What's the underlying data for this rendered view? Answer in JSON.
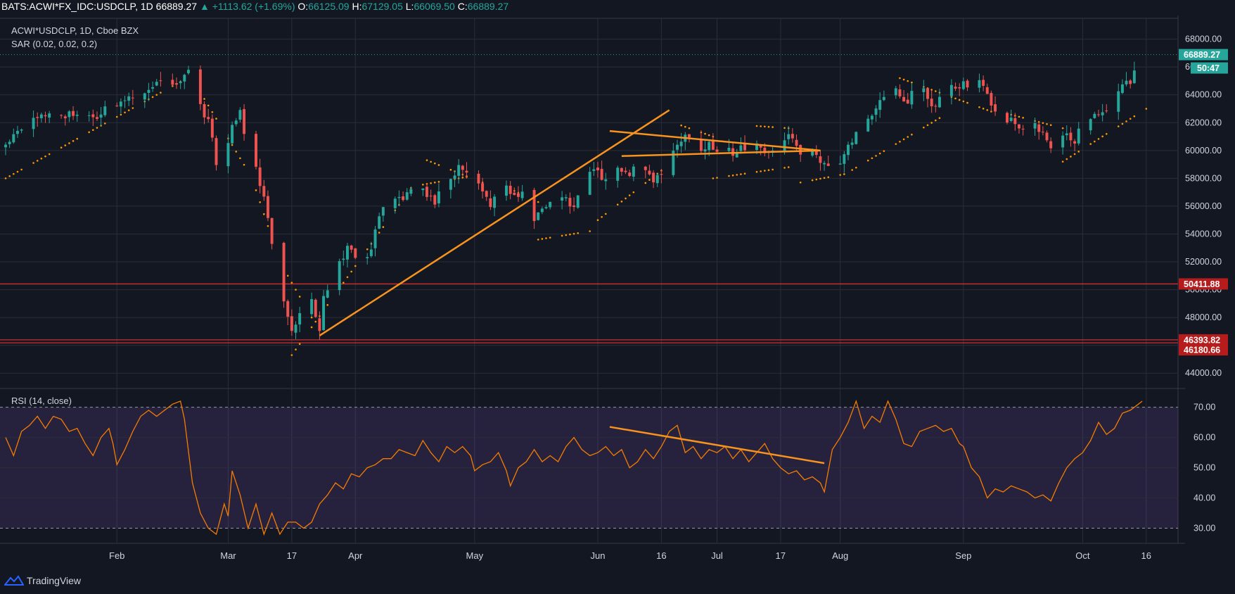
{
  "header": {
    "symbol": "BATS:ACWI*FX_IDC:USDCLP, 1D",
    "last": "66889.27",
    "change": "▲ +1113.62 (+1.69%)",
    "open_label": "O:",
    "open": "66125.09",
    "high_label": "H:",
    "high": "67129.05",
    "low_label": "L:",
    "low": "66069.50",
    "close_label": "C:",
    "close": "66889.27"
  },
  "legend": {
    "main": "ACWI*USDCLP, 1D, Cboe BZX",
    "sar": "SAR (0.02, 0.02, 0.2)",
    "rsi": "RSI (14, close)"
  },
  "footer": {
    "brand": "TradingView",
    "logo_icon": "tradingview-logo-icon"
  },
  "colors": {
    "background": "#131722",
    "grid": "#2a2e39",
    "up": "#26a69a",
    "down": "#ef5350",
    "sar": "#ff9800",
    "trendline": "#f7931e",
    "support": "#d32f2f",
    "rsi_line": "#f57c00",
    "rsi_band": "#7e57c2"
  },
  "chart_data": [
    {
      "type": "candlestick",
      "title": "ACWI*USDCLP, 1D, Cboe BZX",
      "ylim": [
        43000,
        69700
      ],
      "y_ticks": [
        "44000.00",
        "46000.00",
        "48000.00",
        "50000.00",
        "52000.00",
        "54000.00",
        "56000.00",
        "58000.00",
        "60000.00",
        "62000.00",
        "64000.00",
        "66000.00",
        "68000.00"
      ],
      "x_ticks": [
        {
          "label": "Feb",
          "day": 28
        },
        {
          "label": "Mar",
          "day": 56
        },
        {
          "label": "17",
          "day": 72
        },
        {
          "label": "Apr",
          "day": 88
        },
        {
          "label": "May",
          "day": 118
        },
        {
          "label": "Jun",
          "day": 149
        },
        {
          "label": "16",
          "day": 165
        },
        {
          "label": "Jul",
          "day": 179
        },
        {
          "label": "17",
          "day": 195
        },
        {
          "label": "Aug",
          "day": 210
        },
        {
          "label": "Sep",
          "day": 241
        },
        {
          "label": "Oct",
          "day": 271
        },
        {
          "label": "16",
          "day": 287
        }
      ],
      "price_keypoints": [
        [
          0,
          60500
        ],
        [
          3,
          61200
        ],
        [
          7,
          62000
        ],
        [
          11,
          62800
        ],
        [
          15,
          62500
        ],
        [
          19,
          62800
        ],
        [
          23,
          62500
        ],
        [
          27,
          63200
        ],
        [
          31,
          63800
        ],
        [
          35,
          64300
        ],
        [
          39,
          64800
        ],
        [
          44,
          65000
        ],
        [
          46,
          65500
        ],
        [
          48,
          64000
        ],
        [
          51,
          62000
        ],
        [
          53,
          59200
        ],
        [
          55,
          60000
        ],
        [
          57,
          61500
        ],
        [
          59,
          62800
        ],
        [
          61,
          60000
        ],
        [
          63,
          58500
        ],
        [
          65,
          56500
        ],
        [
          66,
          55000
        ],
        [
          68,
          51500
        ],
        [
          70,
          49500
        ],
        [
          71,
          48000
        ],
        [
          72,
          46800
        ],
        [
          74,
          48500
        ],
        [
          76,
          47500
        ],
        [
          77,
          49000
        ],
        [
          78,
          47800
        ],
        [
          79,
          47300
        ],
        [
          80,
          49500
        ],
        [
          82,
          50500
        ],
        [
          84,
          52000
        ],
        [
          86,
          53000
        ],
        [
          88,
          52500
        ],
        [
          90,
          51500
        ],
        [
          92,
          53000
        ],
        [
          94,
          55000
        ],
        [
          96,
          56200
        ],
        [
          98,
          56800
        ],
        [
          100,
          56500
        ],
        [
          102,
          57300
        ],
        [
          104,
          57900
        ],
        [
          106,
          57000
        ],
        [
          108,
          56200
        ],
        [
          110,
          57300
        ],
        [
          112,
          58000
        ],
        [
          114,
          59000
        ],
        [
          116,
          58300
        ],
        [
          118,
          58000
        ],
        [
          120,
          56900
        ],
        [
          122,
          56100
        ],
        [
          124,
          57000
        ],
        [
          126,
          57500
        ],
        [
          128,
          56800
        ],
        [
          130,
          57200
        ],
        [
          132,
          56200
        ],
        [
          133,
          55000
        ],
        [
          135,
          55800
        ],
        [
          137,
          56200
        ],
        [
          139,
          57200
        ],
        [
          141,
          56600
        ],
        [
          143,
          56000
        ],
        [
          145,
          57200
        ],
        [
          147,
          58300
        ],
        [
          149,
          58500
        ],
        [
          151,
          57800
        ],
        [
          153,
          58300
        ],
        [
          155,
          58800
        ],
        [
          157,
          58300
        ],
        [
          159,
          59000
        ],
        [
          161,
          58400
        ],
        [
          163,
          57600
        ],
        [
          165,
          58600
        ],
        [
          167,
          59600
        ],
        [
          169,
          60600
        ],
        [
          171,
          61200
        ],
        [
          173,
          60000
        ],
        [
          175,
          60000
        ],
        [
          177,
          60500
        ],
        [
          179,
          60000
        ],
        [
          181,
          60700
        ],
        [
          183,
          59900
        ],
        [
          185,
          60500
        ],
        [
          187,
          60100
        ],
        [
          189,
          60700
        ],
        [
          191,
          59600
        ],
        [
          193,
          60200
        ],
        [
          195,
          60500
        ],
        [
          197,
          61000
        ],
        [
          199,
          60100
        ],
        [
          201,
          59800
        ],
        [
          203,
          60000
        ],
        [
          205,
          59400
        ],
        [
          207,
          59200
        ],
        [
          209,
          58800
        ],
        [
          211,
          59800
        ],
        [
          213,
          60900
        ],
        [
          215,
          61500
        ],
        [
          217,
          62000
        ],
        [
          219,
          63200
        ],
        [
          221,
          64100
        ],
        [
          223,
          64800
        ],
        [
          225,
          64000
        ],
        [
          227,
          63600
        ],
        [
          229,
          65100
        ],
        [
          231,
          64400
        ],
        [
          233,
          63100
        ],
        [
          235,
          63900
        ],
        [
          237,
          64500
        ],
        [
          239,
          64300
        ],
        [
          241,
          64900
        ],
        [
          243,
          64300
        ],
        [
          245,
          64800
        ],
        [
          247,
          63900
        ],
        [
          249,
          62500
        ],
        [
          251,
          61800
        ],
        [
          253,
          62200
        ],
        [
          255,
          61900
        ],
        [
          257,
          61500
        ],
        [
          259,
          62000
        ],
        [
          261,
          61000
        ],
        [
          263,
          60500
        ],
        [
          265,
          61500
        ],
        [
          267,
          61000
        ],
        [
          269,
          60800
        ],
        [
          271,
          62000
        ],
        [
          273,
          62400
        ],
        [
          275,
          62500
        ],
        [
          277,
          63000
        ],
        [
          279,
          64000
        ],
        [
          281,
          64500
        ],
        [
          283,
          65000
        ],
        [
          285,
          66000
        ],
        [
          286,
          66889.27
        ]
      ],
      "last_price": {
        "value": 66889.27,
        "label": "66889.27",
        "countdown": "50:47"
      },
      "support_lines": [
        {
          "value": 50411.88,
          "label": "50411.88"
        },
        {
          "value": 46393.82,
          "label": "46393.82"
        },
        {
          "value": 46180.66,
          "label": "46180.66"
        }
      ],
      "trend_lines": [
        {
          "from": [
            79,
            46700
          ],
          "to": [
            167,
            62900
          ]
        },
        {
          "from": [
            152,
            61400
          ],
          "to": [
            205,
            60000
          ]
        },
        {
          "from": [
            155,
            59600
          ],
          "to": [
            205,
            60000
          ]
        }
      ],
      "sar_segments": [
        {
          "start": 0,
          "end": 45,
          "from": 58000,
          "to": 65100
        },
        {
          "start": 46,
          "end": 61,
          "from": 65600,
          "to": 58500
        },
        {
          "start": 62,
          "end": 69,
          "from": 58000,
          "to": 52000
        },
        {
          "start": 70,
          "end": 77,
          "from": 51500,
          "to": 48000
        },
        {
          "start": 72,
          "end": 102,
          "from": 45300,
          "to": 57300
        },
        {
          "start": 104,
          "end": 116,
          "from": 57500,
          "to": 58100
        },
        {
          "start": 106,
          "end": 120,
          "from": 59300,
          "to": 57700
        },
        {
          "start": 125,
          "end": 134,
          "from": 57500,
          "to": 56300
        },
        {
          "start": 134,
          "end": 147,
          "from": 53600,
          "to": 54200
        },
        {
          "start": 149,
          "end": 167,
          "from": 55000,
          "to": 59000
        },
        {
          "start": 170,
          "end": 178,
          "from": 61800,
          "to": 61000
        },
        {
          "start": 178,
          "end": 197,
          "from": 58000,
          "to": 58800
        },
        {
          "start": 187,
          "end": 197,
          "from": 61800,
          "to": 61600
        },
        {
          "start": 200,
          "end": 211,
          "from": 57700,
          "to": 58300
        },
        {
          "start": 213,
          "end": 236,
          "from": 58600,
          "to": 62500
        },
        {
          "start": 225,
          "end": 248,
          "from": 65200,
          "to": 62800
        },
        {
          "start": 250,
          "end": 266,
          "from": 62800,
          "to": 61600
        },
        {
          "start": 266,
          "end": 287,
          "from": 59200,
          "to": 63000
        }
      ]
    },
    {
      "type": "line",
      "title": "RSI (14, close)",
      "ylim": [
        25,
        75.5
      ],
      "y_ticks": [
        "30.00",
        "40.00",
        "50.00",
        "60.00",
        "70.00"
      ],
      "bands": {
        "upper": 70,
        "lower": 30
      },
      "rsi_keypoints": [
        [
          0,
          60
        ],
        [
          2,
          54
        ],
        [
          4,
          62
        ],
        [
          6,
          64
        ],
        [
          8,
          67
        ],
        [
          10,
          63
        ],
        [
          12,
          67
        ],
        [
          14,
          66
        ],
        [
          16,
          62
        ],
        [
          18,
          63
        ],
        [
          20,
          58
        ],
        [
          22,
          54
        ],
        [
          24,
          60
        ],
        [
          26,
          63
        ],
        [
          27,
          58
        ],
        [
          28,
          51
        ],
        [
          30,
          56
        ],
        [
          32,
          62
        ],
        [
          34,
          67
        ],
        [
          36,
          69
        ],
        [
          38,
          67
        ],
        [
          40,
          69
        ],
        [
          42,
          71
        ],
        [
          44,
          72
        ],
        [
          45,
          66
        ],
        [
          47,
          45
        ],
        [
          49,
          35
        ],
        [
          51,
          30
        ],
        [
          53,
          28
        ],
        [
          55,
          38
        ],
        [
          56,
          34
        ],
        [
          57,
          49
        ],
        [
          59,
          41
        ],
        [
          61,
          30
        ],
        [
          63,
          38
        ],
        [
          65,
          28
        ],
        [
          67,
          35
        ],
        [
          69,
          28
        ],
        [
          71,
          32
        ],
        [
          73,
          32
        ],
        [
          75,
          30
        ],
        [
          77,
          32
        ],
        [
          79,
          38
        ],
        [
          81,
          41
        ],
        [
          83,
          45
        ],
        [
          85,
          43
        ],
        [
          87,
          48
        ],
        [
          89,
          47
        ],
        [
          91,
          50
        ],
        [
          93,
          51
        ],
        [
          95,
          53
        ],
        [
          97,
          53
        ],
        [
          99,
          56
        ],
        [
          101,
          55
        ],
        [
          103,
          54
        ],
        [
          105,
          59
        ],
        [
          107,
          55
        ],
        [
          109,
          52
        ],
        [
          111,
          57
        ],
        [
          113,
          55
        ],
        [
          115,
          57
        ],
        [
          117,
          54
        ],
        [
          118,
          49
        ],
        [
          120,
          51
        ],
        [
          122,
          52
        ],
        [
          124,
          55
        ],
        [
          126,
          49
        ],
        [
          127,
          44
        ],
        [
          129,
          50
        ],
        [
          131,
          52
        ],
        [
          133,
          56
        ],
        [
          135,
          52
        ],
        [
          137,
          54
        ],
        [
          139,
          52
        ],
        [
          141,
          57
        ],
        [
          143,
          60
        ],
        [
          145,
          56
        ],
        [
          147,
          54
        ],
        [
          149,
          55
        ],
        [
          151,
          57
        ],
        [
          153,
          54
        ],
        [
          155,
          56
        ],
        [
          157,
          50
        ],
        [
          159,
          52
        ],
        [
          161,
          56
        ],
        [
          163,
          53
        ],
        [
          165,
          57
        ],
        [
          167,
          62
        ],
        [
          169,
          64
        ],
        [
          171,
          55
        ],
        [
          173,
          57
        ],
        [
          175,
          53
        ],
        [
          177,
          56
        ],
        [
          179,
          55
        ],
        [
          181,
          57
        ],
        [
          183,
          53
        ],
        [
          185,
          56
        ],
        [
          187,
          52
        ],
        [
          189,
          55
        ],
        [
          191,
          58
        ],
        [
          193,
          53
        ],
        [
          195,
          50
        ],
        [
          197,
          48
        ],
        [
          199,
          49
        ],
        [
          201,
          46
        ],
        [
          203,
          47
        ],
        [
          205,
          45
        ],
        [
          206,
          42
        ],
        [
          208,
          56
        ],
        [
          210,
          60
        ],
        [
          212,
          65
        ],
        [
          214,
          72
        ],
        [
          216,
          63
        ],
        [
          218,
          67
        ],
        [
          220,
          65
        ],
        [
          222,
          72
        ],
        [
          224,
          66
        ],
        [
          226,
          58
        ],
        [
          228,
          57
        ],
        [
          230,
          62
        ],
        [
          232,
          63
        ],
        [
          234,
          64
        ],
        [
          236,
          62
        ],
        [
          238,
          63
        ],
        [
          240,
          58
        ],
        [
          241,
          57
        ],
        [
          243,
          50
        ],
        [
          245,
          47
        ],
        [
          247,
          40
        ],
        [
          249,
          43
        ],
        [
          251,
          42
        ],
        [
          253,
          44
        ],
        [
          255,
          43
        ],
        [
          257,
          42
        ],
        [
          259,
          40
        ],
        [
          261,
          41
        ],
        [
          263,
          39
        ],
        [
          265,
          45
        ],
        [
          267,
          50
        ],
        [
          269,
          53
        ],
        [
          271,
          55
        ],
        [
          273,
          59
        ],
        [
          275,
          65
        ],
        [
          277,
          61
        ],
        [
          279,
          63
        ],
        [
          281,
          68
        ],
        [
          283,
          69
        ],
        [
          285,
          71
        ],
        [
          286,
          72
        ]
      ],
      "trend_lines": [
        {
          "from": [
            152,
            63.5
          ],
          "to": [
            206,
            51.5
          ]
        }
      ]
    }
  ]
}
